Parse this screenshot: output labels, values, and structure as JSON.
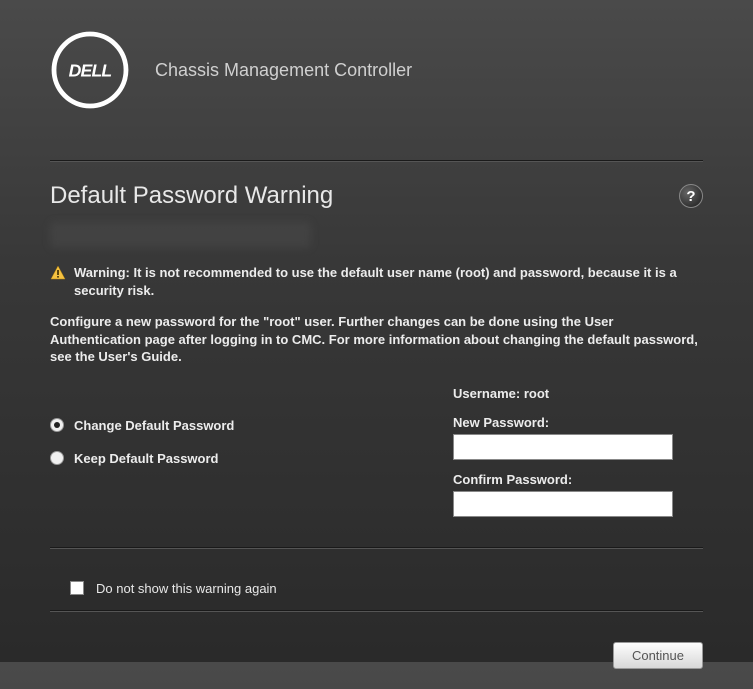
{
  "header": {
    "product_name": "Chassis Management Controller"
  },
  "page": {
    "title": "Default Password Warning"
  },
  "warning": {
    "bold_text": "Warning: It is not recommended to use the default user name (root) and password, because it is a security risk."
  },
  "instructions": "Configure a new password for the \"root\" user. Further changes can be done using the User Authentication page after logging in to CMC. For more information about changing the default password, see the User's Guide.",
  "radios": {
    "change": "Change Default Password",
    "keep": "Keep Default Password"
  },
  "form": {
    "username_label": "Username:",
    "username_value": "root",
    "new_password_label": "New Password:",
    "confirm_password_label": "Confirm Password:"
  },
  "checkbox": {
    "label": "Do not show this warning again"
  },
  "buttons": {
    "continue": "Continue"
  }
}
